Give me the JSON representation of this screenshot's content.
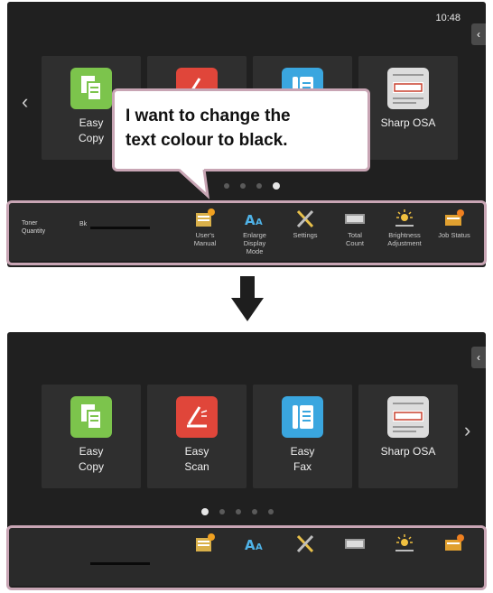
{
  "before": {
    "clock": "10:48",
    "side_tab": "‹",
    "left_arrow": "‹",
    "tiles": [
      {
        "label": "Easy\nCopy",
        "icon": "easy-copy-icon",
        "color": "#7cc44c"
      },
      {
        "label": "",
        "icon": "easy-scan-icon",
        "color": "#e0463a"
      },
      {
        "label": "",
        "icon": "easy-fax-icon",
        "color": "#3aa6df"
      },
      {
        "label": "Sharp OSA",
        "icon": "sharp-osa-icon",
        "color": "#dcdcdc"
      }
    ],
    "dots": 4,
    "active_dot": 3,
    "toner_label": "Toner\nQuantity",
    "toner_letter": "Bk",
    "bar_items": [
      {
        "label": "User's\nManual",
        "icon": "users-manual-icon"
      },
      {
        "label": "Enlarge\nDisplay\nMode",
        "icon": "enlarge-display-icon"
      },
      {
        "label": "Settings",
        "icon": "settings-icon"
      },
      {
        "label": "Total\nCount",
        "icon": "total-count-icon"
      },
      {
        "label": "Brightness\nAdjustment",
        "icon": "brightness-icon"
      },
      {
        "label": "Job Status",
        "icon": "job-status-icon"
      }
    ],
    "callout": "I want to change the\ntext colour to black."
  },
  "after": {
    "side_tab": "‹",
    "right_arrow": "›",
    "tiles": [
      {
        "label": "Easy\nCopy",
        "icon": "easy-copy-icon",
        "color": "#7cc44c"
      },
      {
        "label": "Easy\nScan",
        "icon": "easy-scan-icon",
        "color": "#e0463a"
      },
      {
        "label": "Easy\nFax",
        "icon": "easy-fax-icon",
        "color": "#3aa6df"
      },
      {
        "label": "Sharp OSA",
        "icon": "sharp-osa-icon",
        "color": "#dcdcdc"
      }
    ],
    "dots": 5,
    "active_dot": 0,
    "bar_items": [
      {
        "icon": "users-manual-icon"
      },
      {
        "icon": "enlarge-display-icon"
      },
      {
        "icon": "settings-icon"
      },
      {
        "icon": "total-count-icon"
      },
      {
        "icon": "brightness-icon"
      },
      {
        "icon": "job-status-icon"
      }
    ]
  },
  "colors": {
    "highlight_border": "#c8a5b4",
    "screen_bg": "#202020",
    "arrow": "#1e1e1e"
  }
}
